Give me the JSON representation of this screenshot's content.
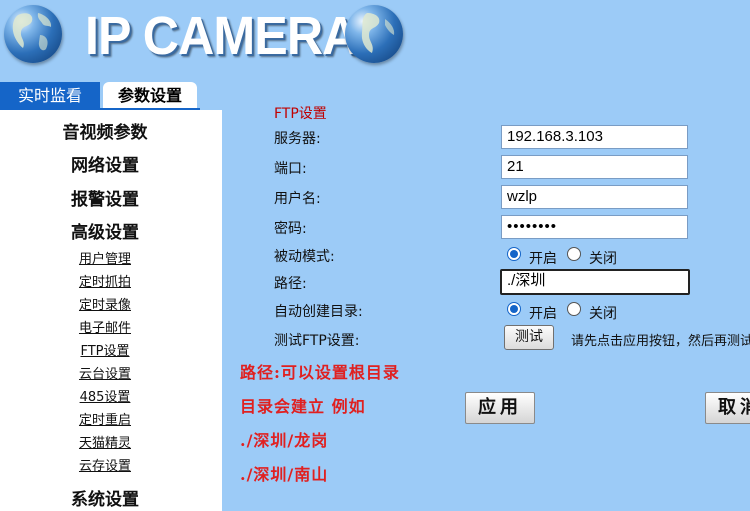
{
  "header": {
    "brand": "IP CAMERA"
  },
  "tabs": [
    {
      "label": "实时监看",
      "active": false
    },
    {
      "label": "参数设置",
      "active": true
    }
  ],
  "menu": {
    "sections": [
      "音视频参数",
      "网络设置",
      "报警设置",
      "高级设置",
      "系统设置"
    ],
    "advanced_items": [
      "用户管理",
      "定时抓拍",
      "定时录像",
      "电子邮件",
      "FTP设置",
      "云台设置",
      "485设置",
      "定时重启",
      "天猫精灵",
      "云存设置"
    ]
  },
  "form": {
    "title": "FTP设置",
    "server_label": "服务器:",
    "server_value": "192.168.3.103",
    "port_label": "端口:",
    "port_value": "21",
    "user_label": "用户名:",
    "user_value": "wzlp",
    "password_label": "密码:",
    "password_value": "••••••••",
    "passive_label": "被动模式:",
    "path_label": "路径:",
    "path_value": "./深圳",
    "autocreate_label": "自动创建目录:",
    "test_label": "测试FTP设置:",
    "on_label": "开启",
    "off_label": "关闭",
    "passive_on": true,
    "autocreate_on": true,
    "test_button": "测试",
    "test_hint": "请先点击应用按钮，然后再测试",
    "apply_button": "应用",
    "cancel_button": "取消"
  },
  "annotations": [
    "路径:可以设置根目录",
    "目录会建立 例如",
    "./深圳/龙岗",
    "./深圳/南山"
  ],
  "colors": {
    "accent": "#1565c8",
    "background": "#9ccbf7",
    "title_red": "#c00000",
    "note_red": "#e02020"
  }
}
